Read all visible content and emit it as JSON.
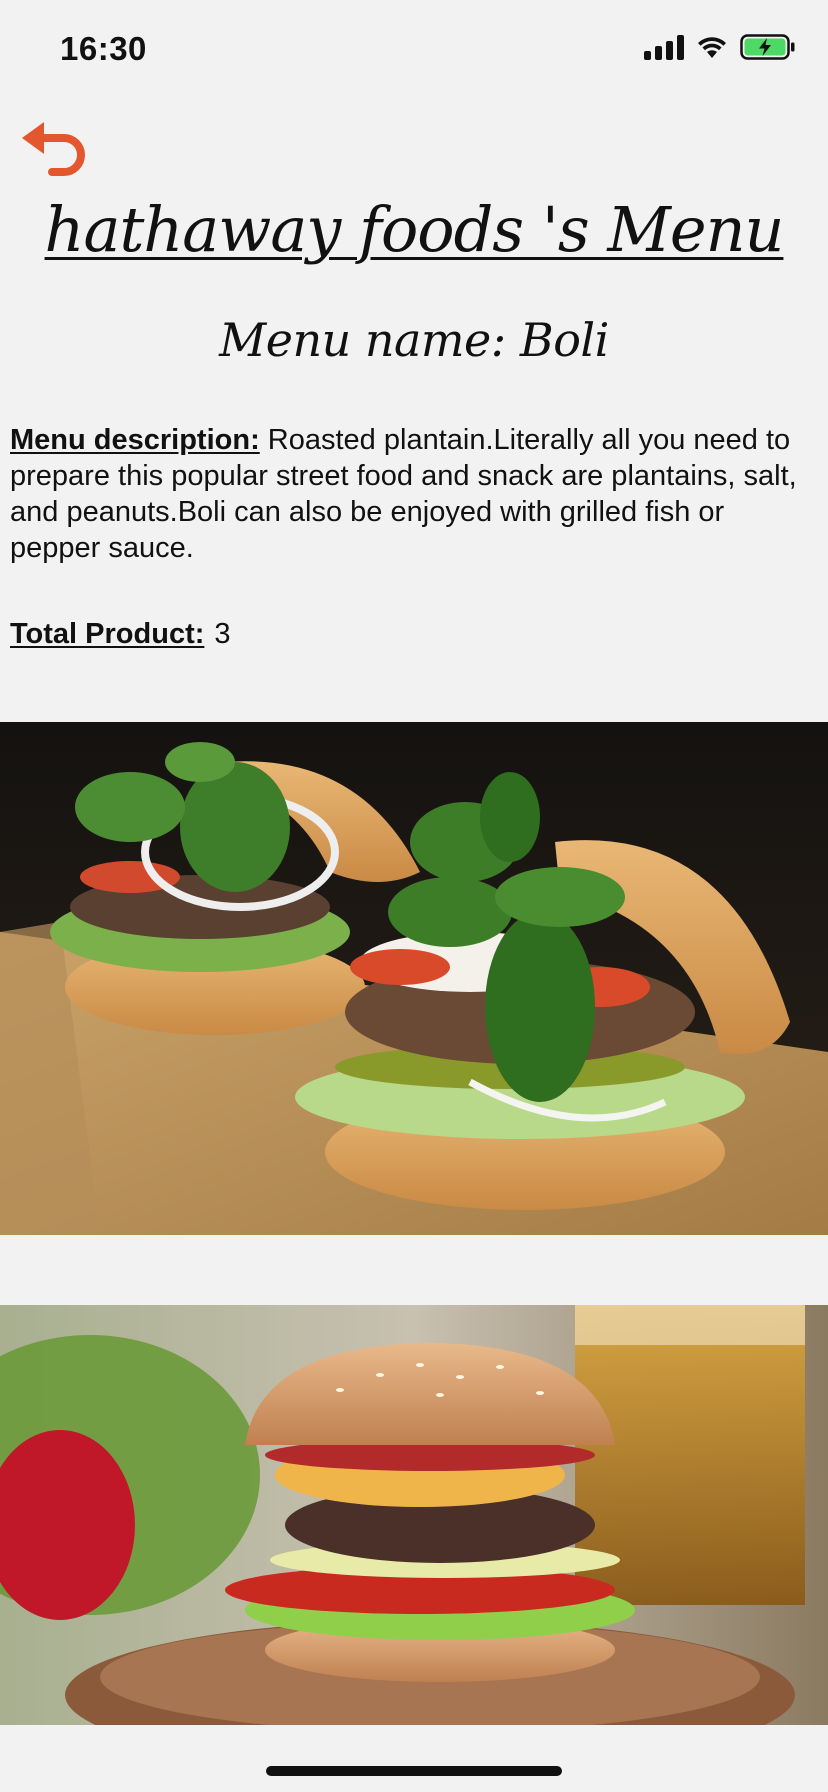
{
  "status_bar": {
    "time": "16:30",
    "icons": [
      "cellular-signal-icon",
      "wifi-icon",
      "battery-charging-icon"
    ],
    "battery_color": "#4cd964"
  },
  "header": {
    "back_icon": "undo-arrow-icon",
    "back_icon_color": "#e4572e",
    "restaurant_title": "hathaway foods 's Menu",
    "menu_name_prefix": "Menu name:",
    "menu_name": "Boli"
  },
  "menu": {
    "description_label": "Menu description:",
    "description": "Roasted plantain.Literally all you need to prepare this popular street food and snack are plantains, salt, and peanuts.Boli can also be enjoyed with grilled fish or pepper sauce.",
    "total_label": "Total Product:",
    "total_value": "3"
  },
  "products": [
    {
      "image": "burger-with-basil-photo"
    },
    {
      "image": "cheeseburger-with-bacon-photo"
    }
  ]
}
